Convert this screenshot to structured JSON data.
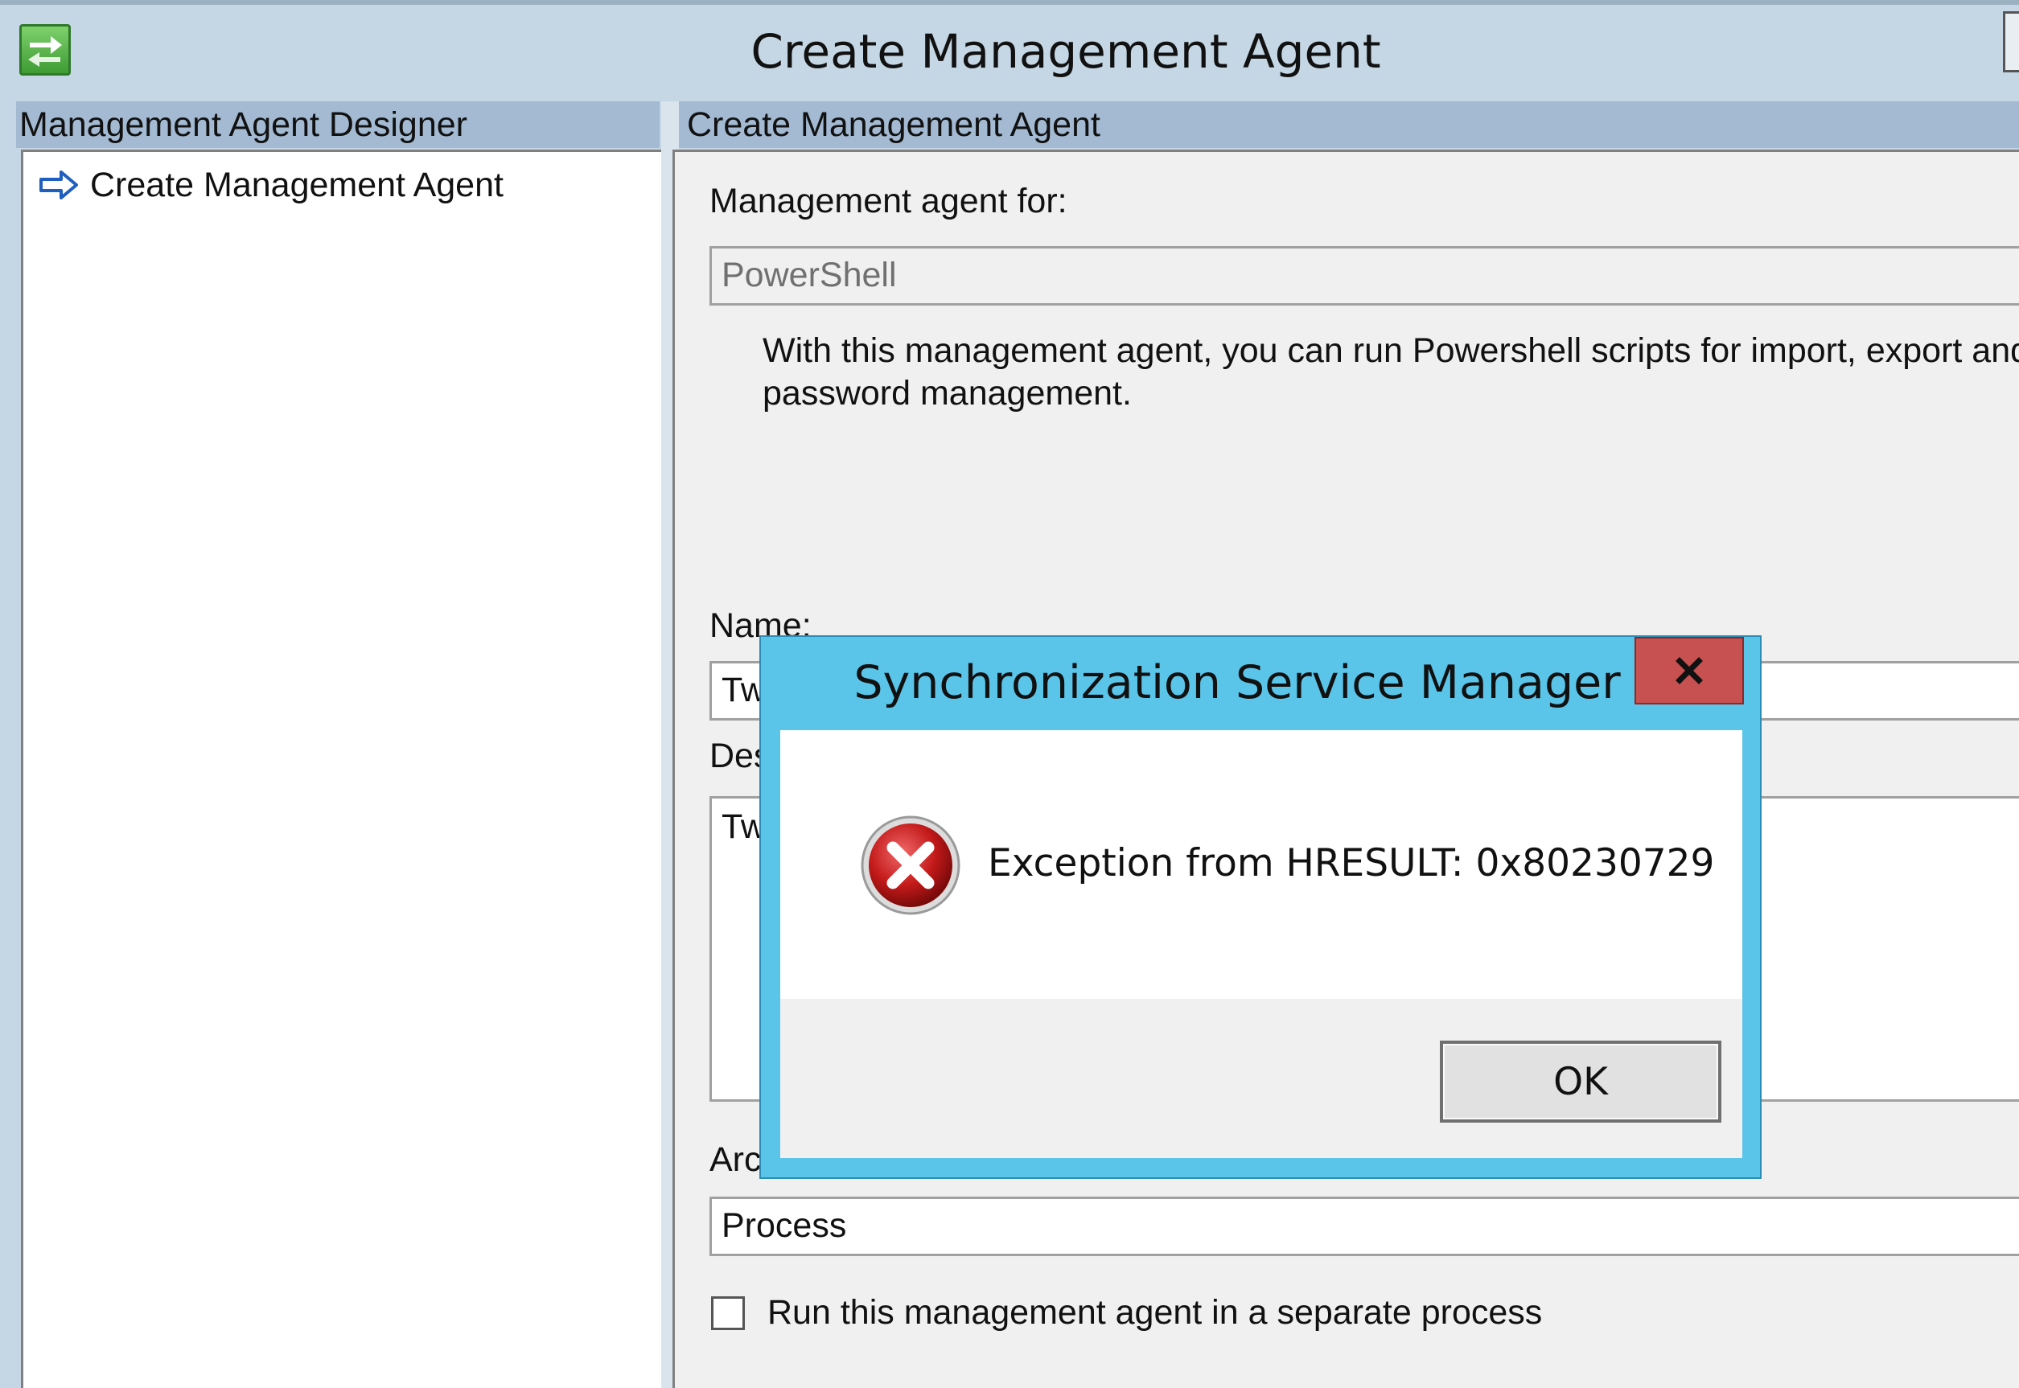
{
  "window": {
    "title": "Create Management Agent",
    "icon": "green-arrows-app-icon"
  },
  "left_pane": {
    "header": "Management Agent Designer",
    "items": [
      {
        "label": "Create Management Agent",
        "icon": "blue-arrow-icon",
        "selected": true
      }
    ]
  },
  "right_pane": {
    "header": "Create Management Agent",
    "ma_for_label": "Management agent for:",
    "ma_for_value": "PowerShell",
    "description": "With this management agent, you can run Powershell scripts for import, export and password management.",
    "name_label_partial": "Name:",
    "name_value_partial": "Tw",
    "description_label_partial": "Des",
    "description_value_partial": "Tw",
    "architecture_label_partial": "Arc",
    "architecture_value": "Process",
    "separate_process_label": "Run this management agent in a separate process",
    "separate_process_checked": false
  },
  "dialog": {
    "title": "Synchronization Service Manager",
    "close_label": "x",
    "message": "Exception from HRESULT: 0x80230729",
    "icon": "error-icon",
    "ok_label": "OK"
  },
  "colors": {
    "pane_header": "#a3bad2",
    "window_chrome": "#c5d7e4",
    "dialog_frame": "#5bc5e9",
    "close_button": "#c75050"
  }
}
